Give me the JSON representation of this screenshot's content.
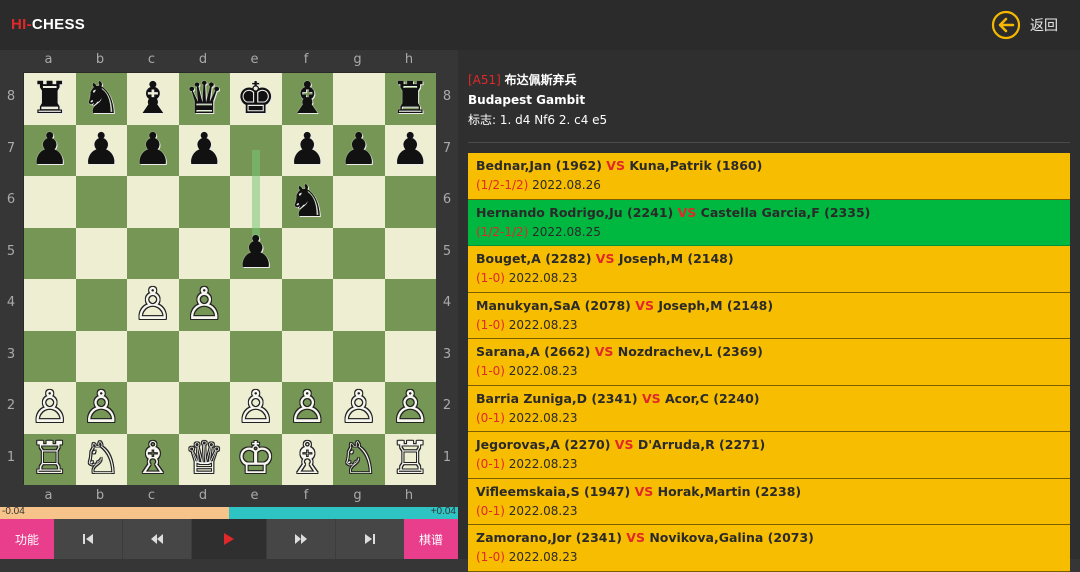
{
  "header": {
    "logo_part1": "HI-",
    "logo_part2": "CHESS",
    "back_label": "返回"
  },
  "board": {
    "files": [
      "a",
      "b",
      "c",
      "d",
      "e",
      "f",
      "g",
      "h"
    ],
    "ranks": [
      "8",
      "7",
      "6",
      "5",
      "4",
      "3",
      "2",
      "1"
    ],
    "pieces": [
      {
        "sq": "a8",
        "p": "♜",
        "c": "b"
      },
      {
        "sq": "b8",
        "p": "♞",
        "c": "b"
      },
      {
        "sq": "c8",
        "p": "♝",
        "c": "b"
      },
      {
        "sq": "d8",
        "p": "♛",
        "c": "b"
      },
      {
        "sq": "e8",
        "p": "♚",
        "c": "b"
      },
      {
        "sq": "f8",
        "p": "♝",
        "c": "b"
      },
      {
        "sq": "h8",
        "p": "♜",
        "c": "b"
      },
      {
        "sq": "a7",
        "p": "♟",
        "c": "b"
      },
      {
        "sq": "b7",
        "p": "♟",
        "c": "b"
      },
      {
        "sq": "c7",
        "p": "♟",
        "c": "b"
      },
      {
        "sq": "d7",
        "p": "♟",
        "c": "b"
      },
      {
        "sq": "f7",
        "p": "♟",
        "c": "b"
      },
      {
        "sq": "g7",
        "p": "♟",
        "c": "b"
      },
      {
        "sq": "h7",
        "p": "♟",
        "c": "b"
      },
      {
        "sq": "f6",
        "p": "♞",
        "c": "b"
      },
      {
        "sq": "e5",
        "p": "♟",
        "c": "b"
      },
      {
        "sq": "c4",
        "p": "♙",
        "c": "w"
      },
      {
        "sq": "d4",
        "p": "♙",
        "c": "w"
      },
      {
        "sq": "a2",
        "p": "♙",
        "c": "w"
      },
      {
        "sq": "b2",
        "p": "♙",
        "c": "w"
      },
      {
        "sq": "e2",
        "p": "♙",
        "c": "w"
      },
      {
        "sq": "f2",
        "p": "♙",
        "c": "w"
      },
      {
        "sq": "g2",
        "p": "♙",
        "c": "w"
      },
      {
        "sq": "h2",
        "p": "♙",
        "c": "w"
      },
      {
        "sq": "a1",
        "p": "♖",
        "c": "w"
      },
      {
        "sq": "b1",
        "p": "♘",
        "c": "w"
      },
      {
        "sq": "c1",
        "p": "♗",
        "c": "w"
      },
      {
        "sq": "d1",
        "p": "♕",
        "c": "w"
      },
      {
        "sq": "e1",
        "p": "♔",
        "c": "w"
      },
      {
        "sq": "f1",
        "p": "♗",
        "c": "w"
      },
      {
        "sq": "g1",
        "p": "♘",
        "c": "w"
      },
      {
        "sq": "h1",
        "p": "♖",
        "c": "w"
      }
    ],
    "last_move": {
      "from": "e7",
      "to": "e5"
    }
  },
  "eval": {
    "left_label": "-0.04",
    "right_label": "+0.04",
    "white_share": 0.5
  },
  "toolbar": {
    "function_label": "功能",
    "library_label": "棋谱",
    "first_icon": "skip-first-icon",
    "prev_icon": "rewind-icon",
    "play_icon": "play-icon",
    "next_icon": "fast-forward-icon",
    "last_icon": "skip-last-icon"
  },
  "opening": {
    "code": "[A51]",
    "name_cn": "布达佩斯弃兵",
    "name_en": "Budapest Gambit",
    "moves_label": "标志:",
    "moves": "1. d4 Nf6 2. c4 e5"
  },
  "games": [
    {
      "white": "Bednar,Jan (1962)",
      "black": "Kuna,Patrik (1860)",
      "result": "(1/2-1/2)",
      "date": "2022.08.26",
      "active": false
    },
    {
      "white": "Hernando Rodrigo,Ju (2241)",
      "black": "Castella Garcia,F (2335)",
      "result": "(1/2-1/2)",
      "date": "2022.08.25",
      "active": true
    },
    {
      "white": "Bouget,A (2282)",
      "black": "Joseph,M (2148)",
      "result": "(1-0)",
      "date": "2022.08.23",
      "active": false
    },
    {
      "white": "Manukyan,SaA (2078)",
      "black": "Joseph,M (2148)",
      "result": "(1-0)",
      "date": "2022.08.23",
      "active": false
    },
    {
      "white": "Sarana,A (2662)",
      "black": "Nozdrachev,L (2369)",
      "result": "(1-0)",
      "date": "2022.08.23",
      "active": false
    },
    {
      "white": "Barria Zuniga,D (2341)",
      "black": "Acor,C (2240)",
      "result": "(0-1)",
      "date": "2022.08.23",
      "active": false
    },
    {
      "white": "Jegorovas,A (2270)",
      "black": "D'Arruda,R (2271)",
      "result": "(0-1)",
      "date": "2022.08.23",
      "active": false
    },
    {
      "white": "Vifleemskaia,S (1947)",
      "black": "Horak,Martin (2238)",
      "result": "(0-1)",
      "date": "2022.08.23",
      "active": false
    },
    {
      "white": "Zamorano,Jor (2341)",
      "black": "Novikova,Galina (2073)",
      "result": "(1-0)",
      "date": "2022.08.23",
      "active": false
    }
  ],
  "vs_label": "VS",
  "colors": {
    "accent_red": "#e0282a",
    "row_yellow": "#f7bd00",
    "row_green": "#00b840",
    "square_light": "#eeeed2",
    "square_dark": "#769656",
    "pink_button": "#e83e8c"
  }
}
